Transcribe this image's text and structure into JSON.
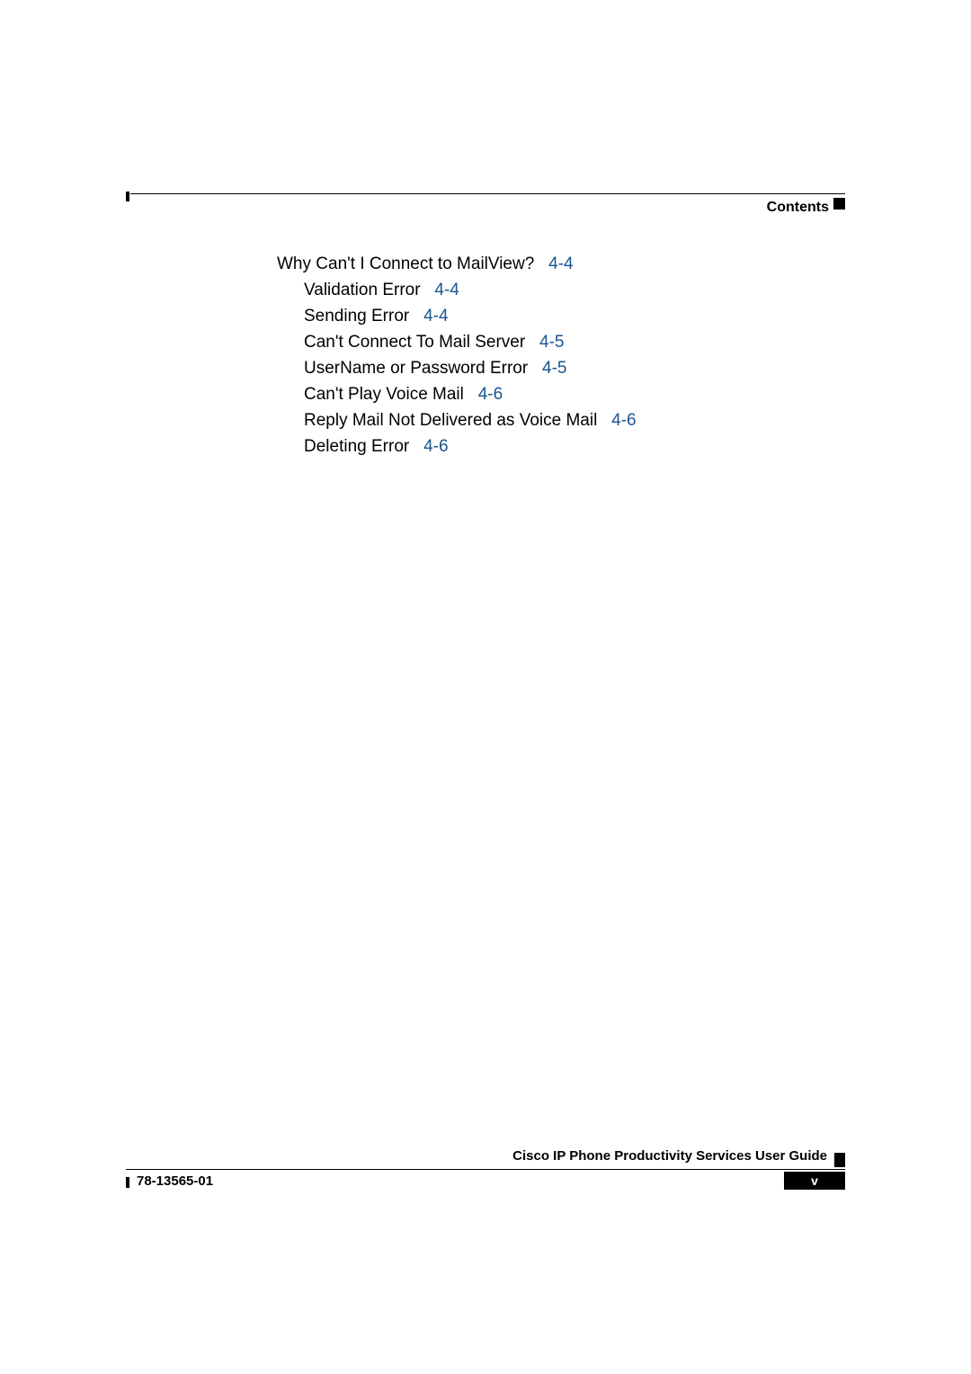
{
  "header": {
    "label": "Contents"
  },
  "toc": {
    "main": {
      "text": "Why Can't I Connect to MailView?",
      "ref": "4-4"
    },
    "items": [
      {
        "text": "Validation Error",
        "ref": "4-4"
      },
      {
        "text": "Sending Error",
        "ref": "4-4"
      },
      {
        "text": "Can't Connect To Mail Server",
        "ref": "4-5"
      },
      {
        "text": "UserName or Password Error",
        "ref": "4-5"
      },
      {
        "text": "Can't Play Voice Mail",
        "ref": "4-6"
      },
      {
        "text": "Reply Mail Not Delivered as Voice Mail",
        "ref": "4-6"
      },
      {
        "text": "Deleting Error",
        "ref": "4-6"
      }
    ]
  },
  "footer": {
    "title": "Cisco IP Phone Productivity Services User Guide",
    "docnum": "78-13565-01",
    "pagenum": "v"
  }
}
